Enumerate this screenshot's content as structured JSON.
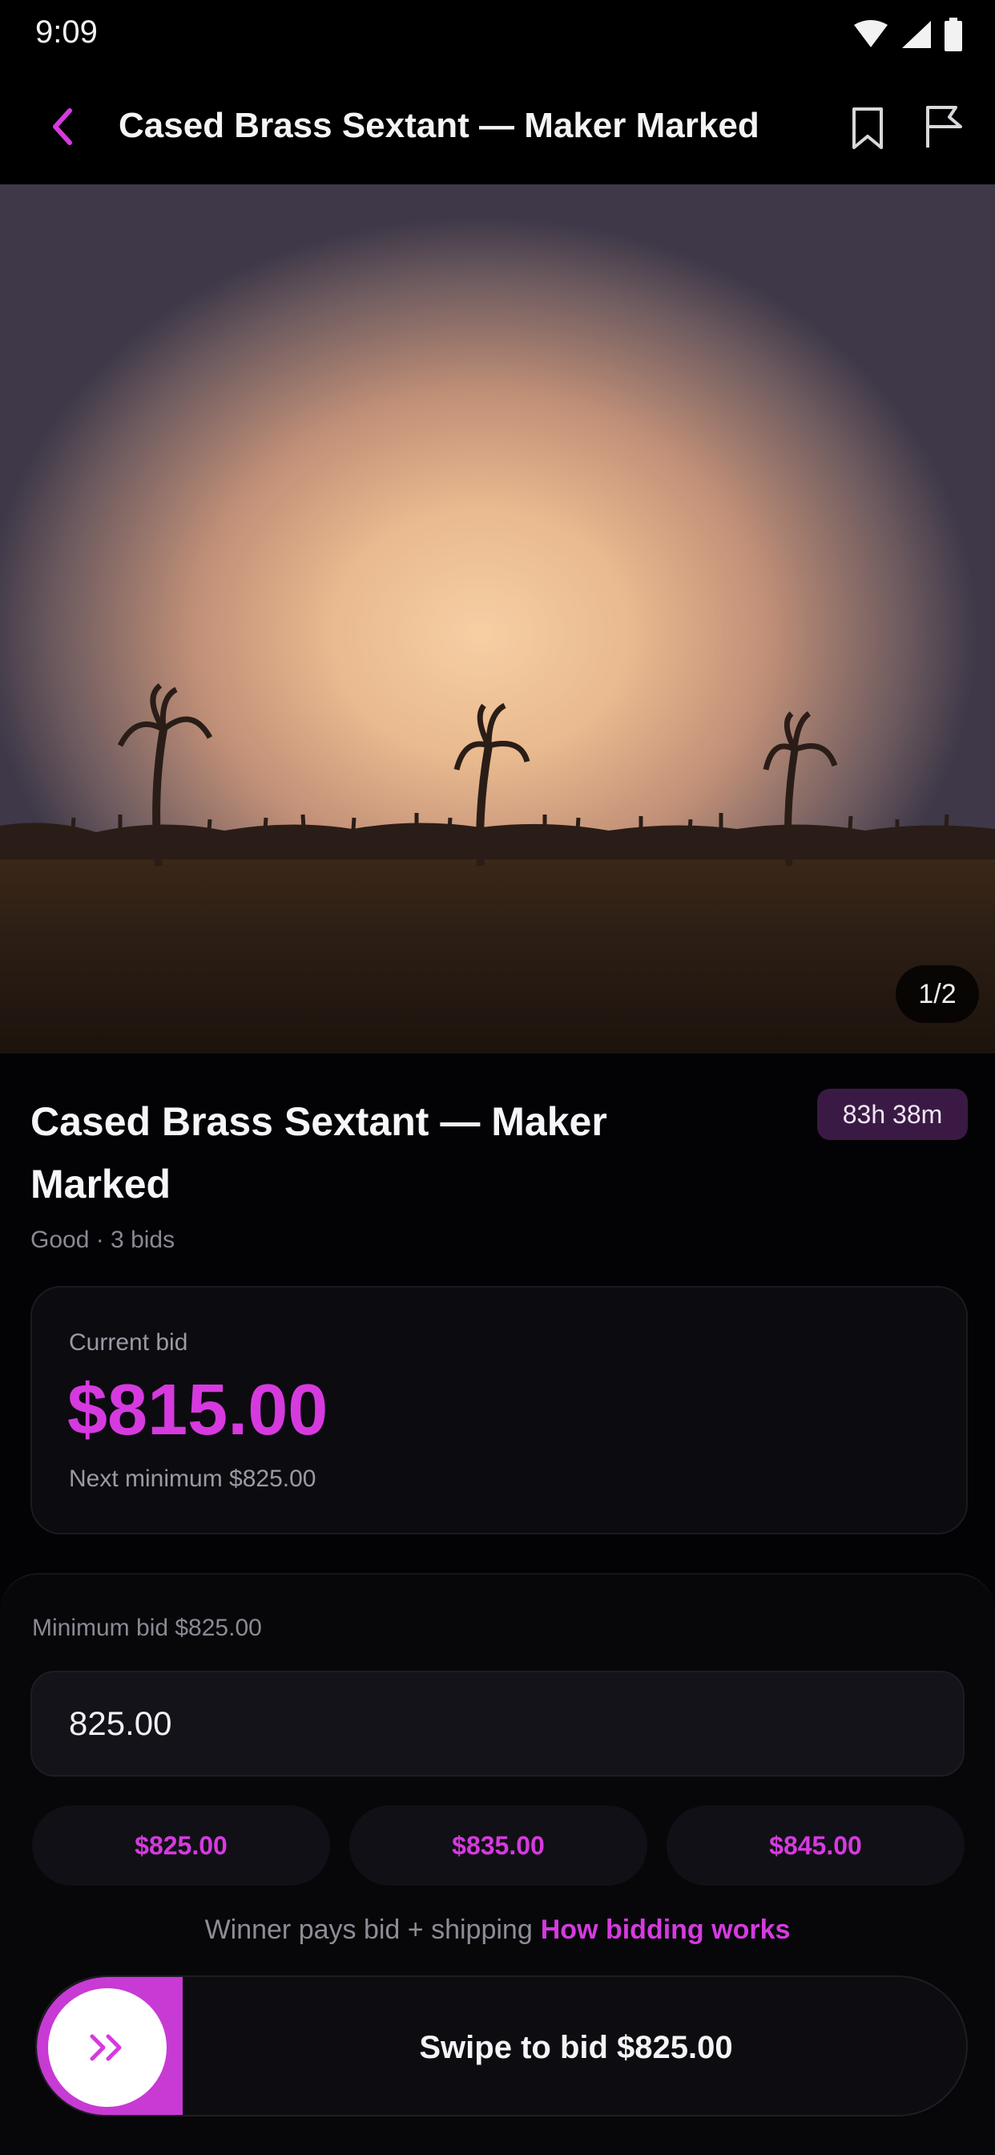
{
  "status_bar": {
    "time": "9:09"
  },
  "app_bar": {
    "title": "Cased Brass Sextant — Maker Marked"
  },
  "gallery": {
    "counter": "1/2"
  },
  "listing": {
    "title": "Cased Brass Sextant — Maker Marked",
    "time_left": "83h 38m",
    "meta": "Good · 3 bids"
  },
  "bid_card": {
    "label": "Current bid",
    "amount": "$815.00",
    "next_minimum": "Next minimum $825.00"
  },
  "bid_sheet": {
    "min_label": "Minimum bid $825.00",
    "input_value": "825.00",
    "quick_bids": [
      "$825.00",
      "$835.00",
      "$845.00"
    ],
    "footnote": "Winner pays bid + shipping",
    "footnote_link": "How bidding works",
    "swipe_label": "Swipe to bid $825.00"
  },
  "colors": {
    "accent": "#d63adf",
    "background": "#030305"
  },
  "icons": [
    "wifi-icon",
    "signal-icon",
    "battery-icon",
    "back-chevron-icon",
    "bookmark-icon",
    "flag-icon",
    "double-chevron-right-icon"
  ]
}
